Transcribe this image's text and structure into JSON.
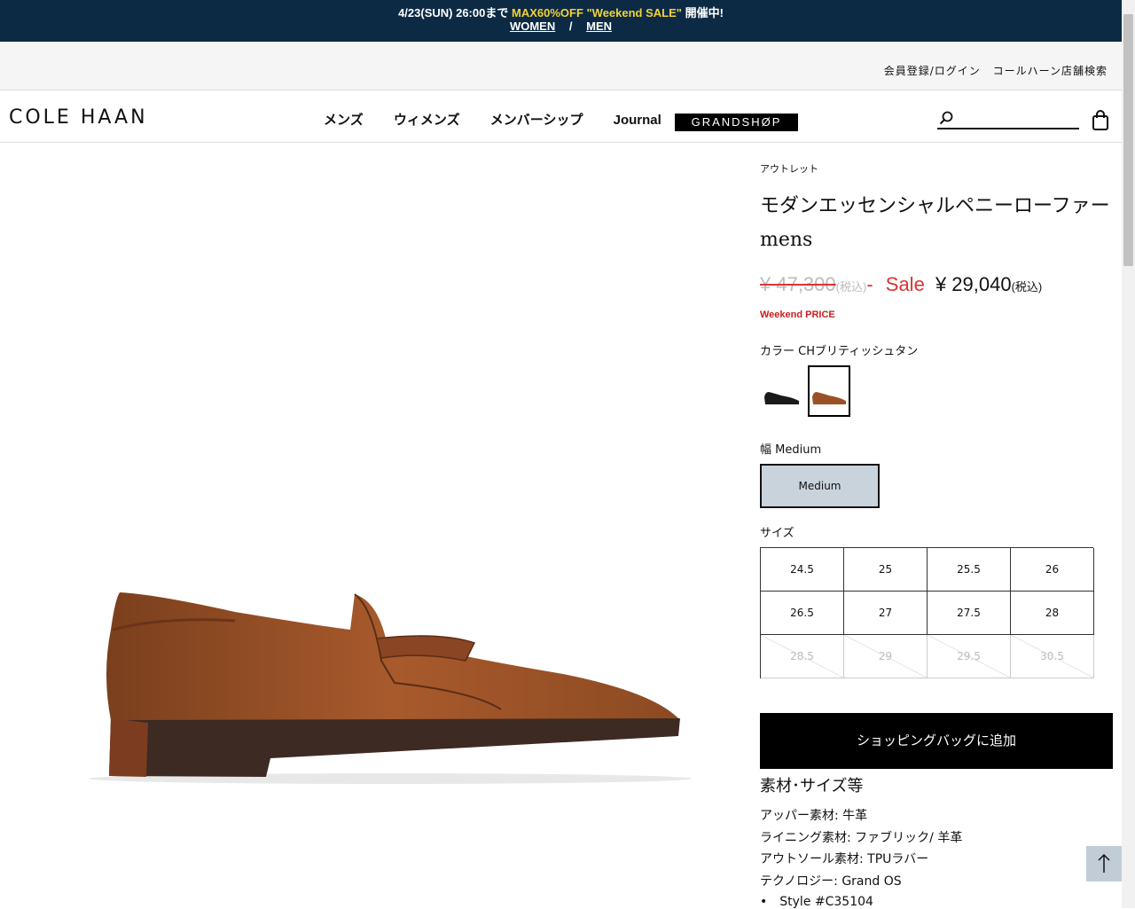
{
  "promo": {
    "date": "4/23(SUN) 26:00まで",
    "highlight": "MAX60%OFF \"Weekend SALE\"",
    "suffix": "開催中!",
    "women": "WOMEN",
    "sep": "/",
    "men": "MEN"
  },
  "util": {
    "login": "会員登録/ログイン",
    "stores": "コールハーン店舗検索"
  },
  "nav": {
    "logo": "COLE HAAN",
    "items": [
      "メンズ",
      "ウィメンズ",
      "メンバーシップ",
      "Journal"
    ],
    "grandshop": "GRANDSHØP",
    "search_placeholder": ""
  },
  "product": {
    "breadcrumb": "アウトレット",
    "title": "モダンエッセンシャルペニーローファー mens",
    "old_price": "¥ 47,300",
    "tax_label": "(税込)",
    "dash": "-",
    "sale_label": "Sale",
    "price": "¥ 29,040",
    "weekend": "Weekend PRICE",
    "color_label": "カラー CHブリティッシュタン",
    "width_label": "幅 Medium",
    "width_option": "Medium",
    "size_label": "サイズ",
    "sizes": [
      {
        "v": "24.5",
        "available": true
      },
      {
        "v": "25",
        "available": true
      },
      {
        "v": "25.5",
        "available": true
      },
      {
        "v": "26",
        "available": true
      },
      {
        "v": "26.5",
        "available": true
      },
      {
        "v": "27",
        "available": true
      },
      {
        "v": "27.5",
        "available": true
      },
      {
        "v": "28",
        "available": true
      },
      {
        "v": "28.5",
        "available": false
      },
      {
        "v": "29",
        "available": false
      },
      {
        "v": "29.5",
        "available": false
      },
      {
        "v": "30.5",
        "available": false
      }
    ],
    "add_to_bag": "ショッピングバッグに追加",
    "spec_heading": "素材･サイズ等",
    "specs": [
      "アッパー素材: 牛革",
      "ライニング素材: ファブリック/ 羊革",
      "アウトソール素材: TPUラバー",
      "テクノロジー: Grand OS"
    ],
    "style": "Style #C35104"
  },
  "colors": {
    "promo_bg": "#0c2a44",
    "highlight": "#f2d23b",
    "sale": "#d33333",
    "width_selected": "#c9d3dc"
  }
}
